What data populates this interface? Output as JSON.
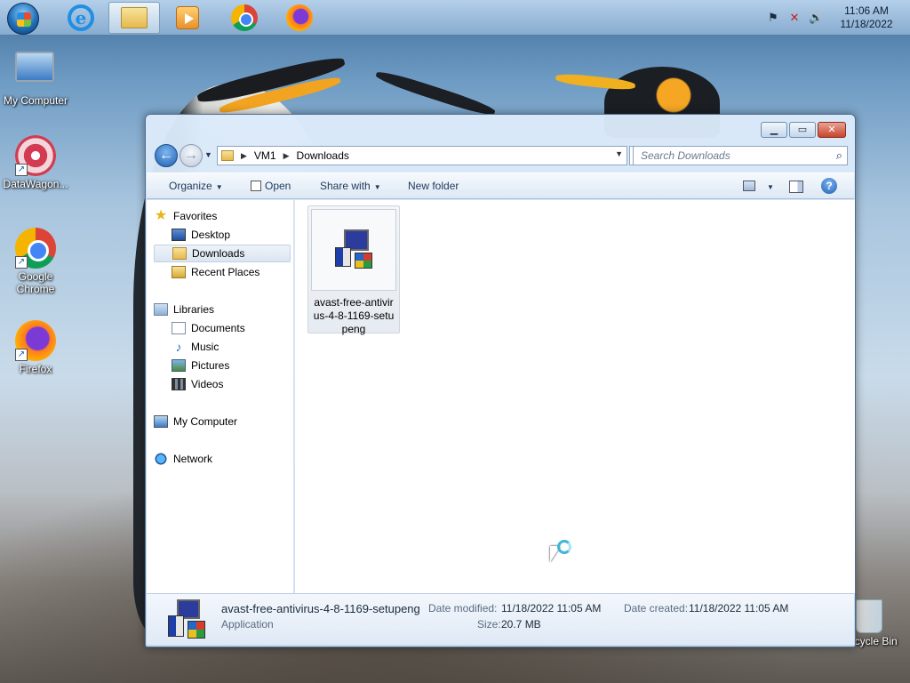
{
  "taskbar": {
    "clock_time": "11:06 AM",
    "clock_date": "11/18/2022",
    "pinned": [
      {
        "name": "internet-explorer",
        "icon": "ie-icon"
      },
      {
        "name": "windows-explorer",
        "icon": "folder-icon",
        "active": true
      },
      {
        "name": "media-player",
        "icon": "media-player-icon"
      },
      {
        "name": "google-chrome",
        "icon": "chrome-icon"
      },
      {
        "name": "firefox",
        "icon": "firefox-icon"
      }
    ]
  },
  "desktop": {
    "icons": [
      {
        "label": "My Computer"
      },
      {
        "label": "DataWagon..."
      },
      {
        "label": "Google Chrome"
      },
      {
        "label": "Firefox"
      },
      {
        "label": "Recycle Bin"
      }
    ]
  },
  "explorer": {
    "breadcrumb": [
      "VM1",
      "Downloads"
    ],
    "search_placeholder": "Search Downloads",
    "toolbar": {
      "organize": "Organize",
      "open": "Open",
      "share_with": "Share with",
      "new_folder": "New folder"
    },
    "nav": {
      "favorites": "Favorites",
      "desktop": "Desktop",
      "downloads": "Downloads",
      "recent_places": "Recent Places",
      "libraries": "Libraries",
      "documents": "Documents",
      "music": "Music",
      "pictures": "Pictures",
      "videos": "Videos",
      "my_computer": "My Computer",
      "network": "Network"
    },
    "files": [
      {
        "name_line1": "avast-free-antivir",
        "name_line2": "us-4-8-1169-setu",
        "name_line3": "peng"
      }
    ],
    "details": {
      "file_name": "avast-free-antivirus-4-8-1169-setupeng",
      "file_type": "Application",
      "date_modified_label": "Date modified:",
      "date_modified": "11/18/2022 11:05 AM",
      "date_created_label": "Date created:",
      "date_created": "11/18/2022 11:05 AM",
      "size_label": "Size:",
      "size": "20.7 MB"
    }
  }
}
